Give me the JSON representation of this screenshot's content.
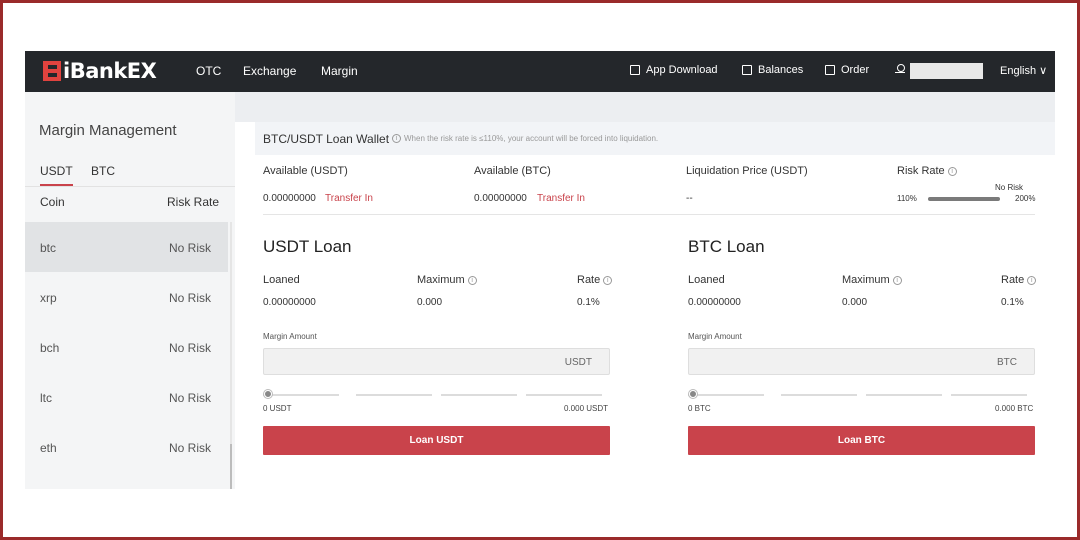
{
  "nav": {
    "logo_text": "iBankEX",
    "links": [
      "OTC",
      "Exchange",
      "Margin"
    ],
    "app_download": "App Download",
    "balances": "Balances",
    "order": "Order",
    "language": "English ∨"
  },
  "sidebar": {
    "title": "Margin Management",
    "tabs": [
      "USDT",
      "BTC"
    ],
    "columns": {
      "coin": "Coin",
      "risk": "Risk Rate"
    },
    "rows": [
      {
        "coin": "btc",
        "risk": "No Risk"
      },
      {
        "coin": "xrp",
        "risk": "No Risk"
      },
      {
        "coin": "bch",
        "risk": "No Risk"
      },
      {
        "coin": "ltc",
        "risk": "No Risk"
      },
      {
        "coin": "eth",
        "risk": "No Risk"
      }
    ]
  },
  "wallet": {
    "title": "BTC/USDT Loan Wallet",
    "note": "When the risk rate is ≤110%, your account will be forced into liquidation.",
    "available_usdt_label": "Available (USDT)",
    "available_usdt_value": "0.00000000",
    "available_btc_label": "Available (BTC)",
    "available_btc_value": "0.00000000",
    "transfer_in": "Transfer In",
    "liq_price_label": "Liquidation Price (USDT)",
    "liq_price_value": "--",
    "risk_rate_label": "Risk Rate",
    "risk_min": "110%",
    "risk_max": "200%",
    "risk_status": "No Risk"
  },
  "usdt_loan": {
    "title": "USDT Loan",
    "loaned_label": "Loaned",
    "loaned_value": "0.00000000",
    "maximum_label": "Maximum",
    "maximum_value": "0.000",
    "rate_label": "Rate",
    "rate_value": "0.1%",
    "margin_amount_label": "Margin Amount",
    "unit": "USDT",
    "slider_min": "0 USDT",
    "slider_max": "0.000 USDT",
    "slider_value": 0,
    "button": "Loan USDT"
  },
  "btc_loan": {
    "title": "BTC Loan",
    "loaned_label": "Loaned",
    "loaned_value": "0.00000000",
    "maximum_label": "Maximum",
    "maximum_value": "0.000",
    "rate_label": "Rate",
    "rate_value": "0.1%",
    "margin_amount_label": "Margin Amount",
    "unit": "BTC",
    "slider_min": "0 BTC",
    "slider_max": "0.000 BTC",
    "slider_value": 0,
    "button": "Loan BTC"
  },
  "colors": {
    "accent": "#c9434b",
    "nav_bg": "#24272b",
    "logo": "#e0433f"
  }
}
